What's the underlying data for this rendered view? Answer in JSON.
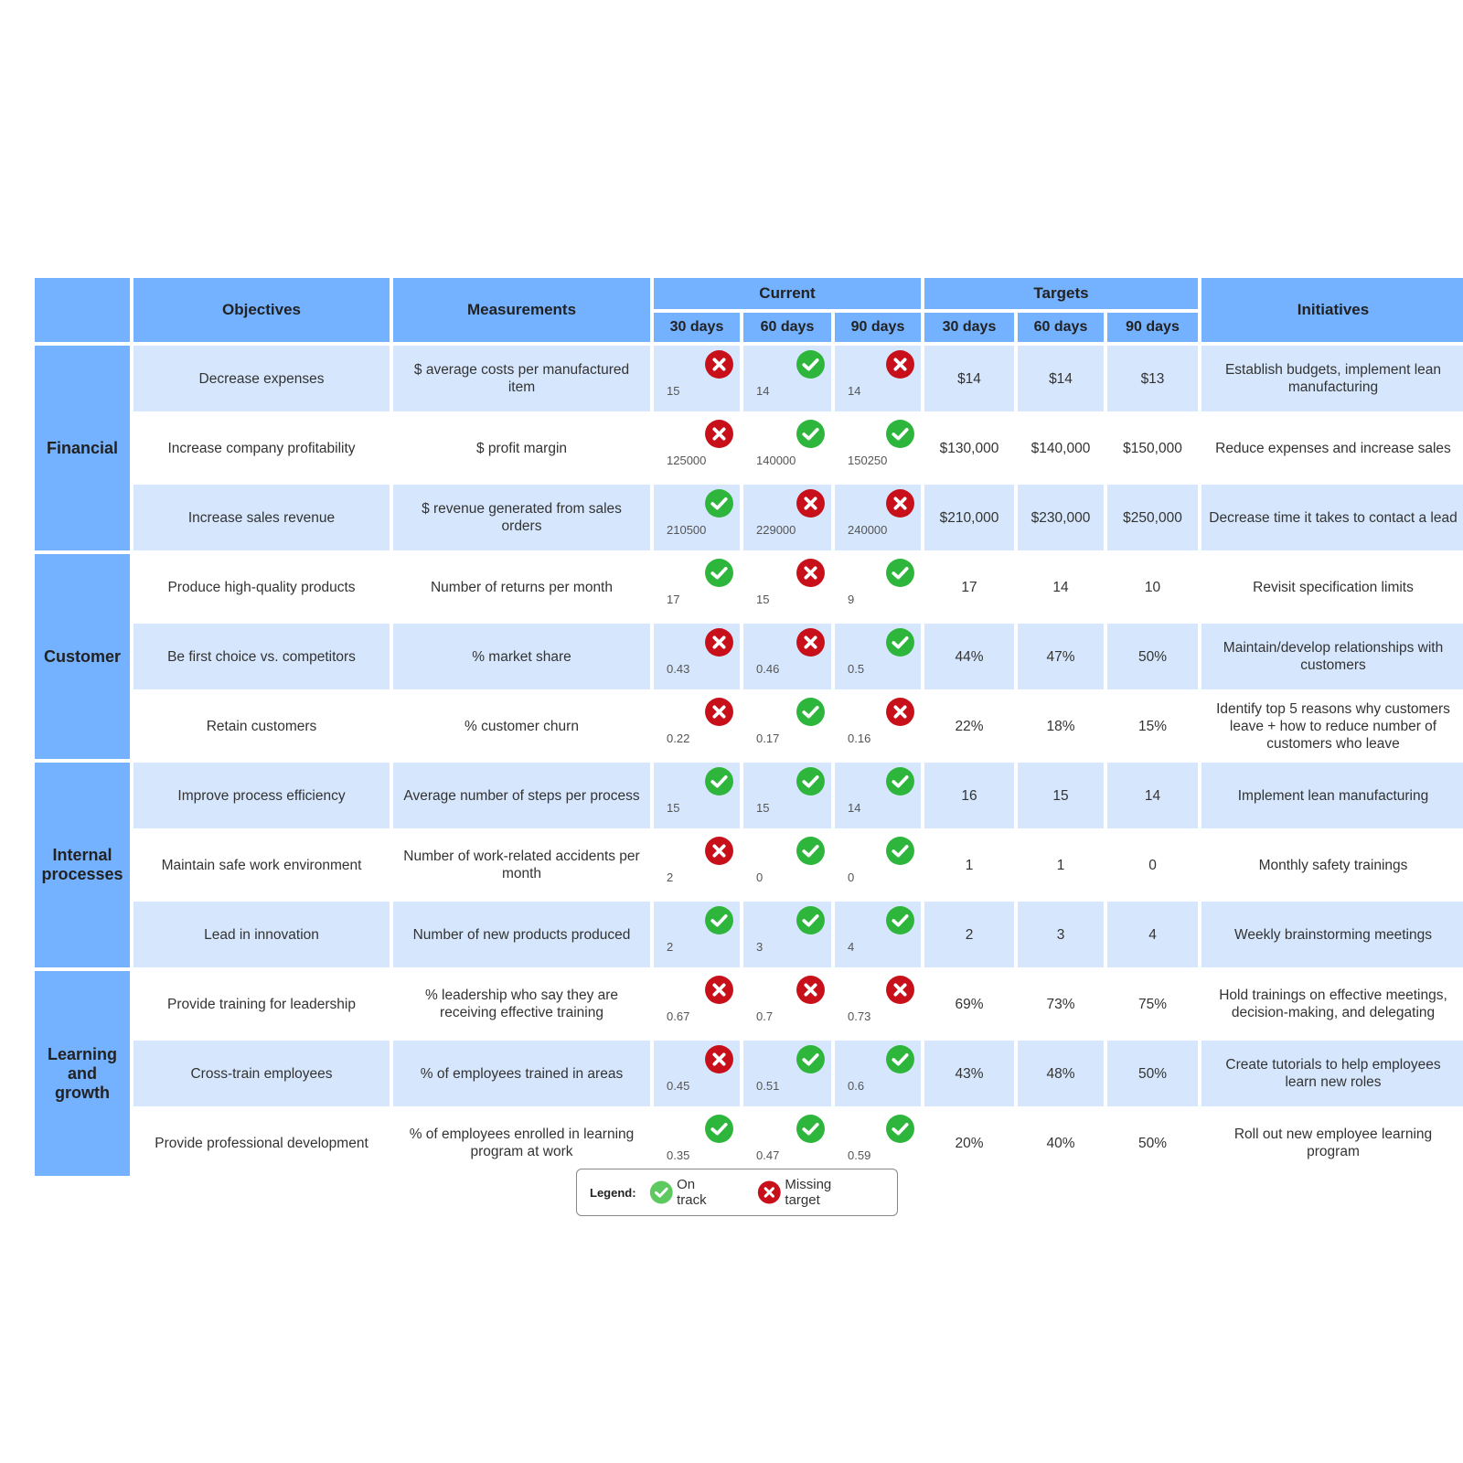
{
  "header": {
    "objectives": "Objectives",
    "measurements": "Measurements",
    "current": "Current",
    "targets": "Targets",
    "initiatives": "Initiatives",
    "periods": [
      "30 days",
      "60 days",
      "90 days"
    ]
  },
  "colors": {
    "header_blue": "#74b1ff",
    "row_alt": "#d6e7fd",
    "on_track": "#2db53c",
    "missing": "#c8101a"
  },
  "perspectives": [
    {
      "label": "Financial",
      "rows": [
        {
          "objective": "Decrease expenses",
          "measurement": "$ average costs per manufactured item",
          "current": [
            {
              "value": "15",
              "status": "missing"
            },
            {
              "value": "14",
              "status": "on-track"
            },
            {
              "value": "14",
              "status": "missing"
            }
          ],
          "targets": [
            "$14",
            "$14",
            "$13"
          ],
          "initiative": "Establish budgets, implement lean manufacturing"
        },
        {
          "objective": "Increase company profitability",
          "measurement": "$ profit margin",
          "current": [
            {
              "value": "125000",
              "status": "missing"
            },
            {
              "value": "140000",
              "status": "on-track"
            },
            {
              "value": "150250",
              "status": "on-track"
            }
          ],
          "targets": [
            "$130,000",
            "$140,000",
            "$150,000"
          ],
          "initiative": "Reduce expenses and increase sales"
        },
        {
          "objective": "Increase sales revenue",
          "measurement": "$ revenue generated from sales orders",
          "current": [
            {
              "value": "210500",
              "status": "on-track"
            },
            {
              "value": "229000",
              "status": "missing"
            },
            {
              "value": "240000",
              "status": "missing"
            }
          ],
          "targets": [
            "$210,000",
            "$230,000",
            "$250,000"
          ],
          "initiative": "Decrease time it takes to contact a lead"
        }
      ]
    },
    {
      "label": "Customer",
      "rows": [
        {
          "objective": "Produce high-quality products",
          "measurement": "Number of returns per month",
          "current": [
            {
              "value": "17",
              "status": "on-track"
            },
            {
              "value": "15",
              "status": "missing"
            },
            {
              "value": "9",
              "status": "on-track"
            }
          ],
          "targets": [
            "17",
            "14",
            "10"
          ],
          "initiative": "Revisit specification limits"
        },
        {
          "objective": "Be first choice vs. competitors",
          "measurement": "% market share",
          "current": [
            {
              "value": "0.43",
              "status": "missing"
            },
            {
              "value": "0.46",
              "status": "missing"
            },
            {
              "value": "0.5",
              "status": "on-track"
            }
          ],
          "targets": [
            "44%",
            "47%",
            "50%"
          ],
          "initiative": "Maintain/develop relationships with customers"
        },
        {
          "objective": "Retain customers",
          "measurement": "% customer churn",
          "current": [
            {
              "value": "0.22",
              "status": "missing"
            },
            {
              "value": "0.17",
              "status": "on-track"
            },
            {
              "value": "0.16",
              "status": "missing"
            }
          ],
          "targets": [
            "22%",
            "18%",
            "15%"
          ],
          "initiative": "Identify top 5 reasons why customers leave + how to reduce number of customers who leave"
        }
      ]
    },
    {
      "label": "Internal processes",
      "rows": [
        {
          "objective": "Improve process efficiency",
          "measurement": "Average number of steps per process",
          "current": [
            {
              "value": "15",
              "status": "on-track"
            },
            {
              "value": "15",
              "status": "on-track"
            },
            {
              "value": "14",
              "status": "on-track"
            }
          ],
          "targets": [
            "16",
            "15",
            "14"
          ],
          "initiative": "Implement lean manufacturing"
        },
        {
          "objective": "Maintain safe work environment",
          "measurement": "Number of work-related accidents per month",
          "current": [
            {
              "value": "2",
              "status": "missing"
            },
            {
              "value": "0",
              "status": "on-track"
            },
            {
              "value": "0",
              "status": "on-track"
            }
          ],
          "targets": [
            "1",
            "1",
            "0"
          ],
          "initiative": "Monthly safety trainings"
        },
        {
          "objective": "Lead in innovation",
          "measurement": "Number of new products produced",
          "current": [
            {
              "value": "2",
              "status": "on-track"
            },
            {
              "value": "3",
              "status": "on-track"
            },
            {
              "value": "4",
              "status": "on-track"
            }
          ],
          "targets": [
            "2",
            "3",
            "4"
          ],
          "initiative": "Weekly brainstorming meetings"
        }
      ]
    },
    {
      "label": "Learning and growth",
      "rows": [
        {
          "objective": "Provide training for leadership",
          "measurement": "% leadership who say they are receiving effective training",
          "current": [
            {
              "value": "0.67",
              "status": "missing"
            },
            {
              "value": "0.7",
              "status": "missing"
            },
            {
              "value": "0.73",
              "status": "missing"
            }
          ],
          "targets": [
            "69%",
            "73%",
            "75%"
          ],
          "initiative": "Hold trainings on effective meetings, decision-making, and delegating"
        },
        {
          "objective": "Cross-train employees",
          "measurement": "% of employees trained in areas",
          "current": [
            {
              "value": "0.45",
              "status": "missing"
            },
            {
              "value": "0.51",
              "status": "on-track"
            },
            {
              "value": "0.6",
              "status": "on-track"
            }
          ],
          "targets": [
            "43%",
            "48%",
            "50%"
          ],
          "initiative": "Create tutorials to help employees learn new roles"
        },
        {
          "objective": "Provide professional development",
          "measurement": "% of employees enrolled in learning program at work",
          "current": [
            {
              "value": "0.35",
              "status": "on-track"
            },
            {
              "value": "0.47",
              "status": "on-track"
            },
            {
              "value": "0.59",
              "status": "on-track"
            }
          ],
          "targets": [
            "20%",
            "40%",
            "50%"
          ],
          "initiative": "Roll out new employee learning program"
        }
      ]
    }
  ],
  "legend": {
    "label": "Legend:",
    "on_track": "On track",
    "missing": "Missing target"
  }
}
